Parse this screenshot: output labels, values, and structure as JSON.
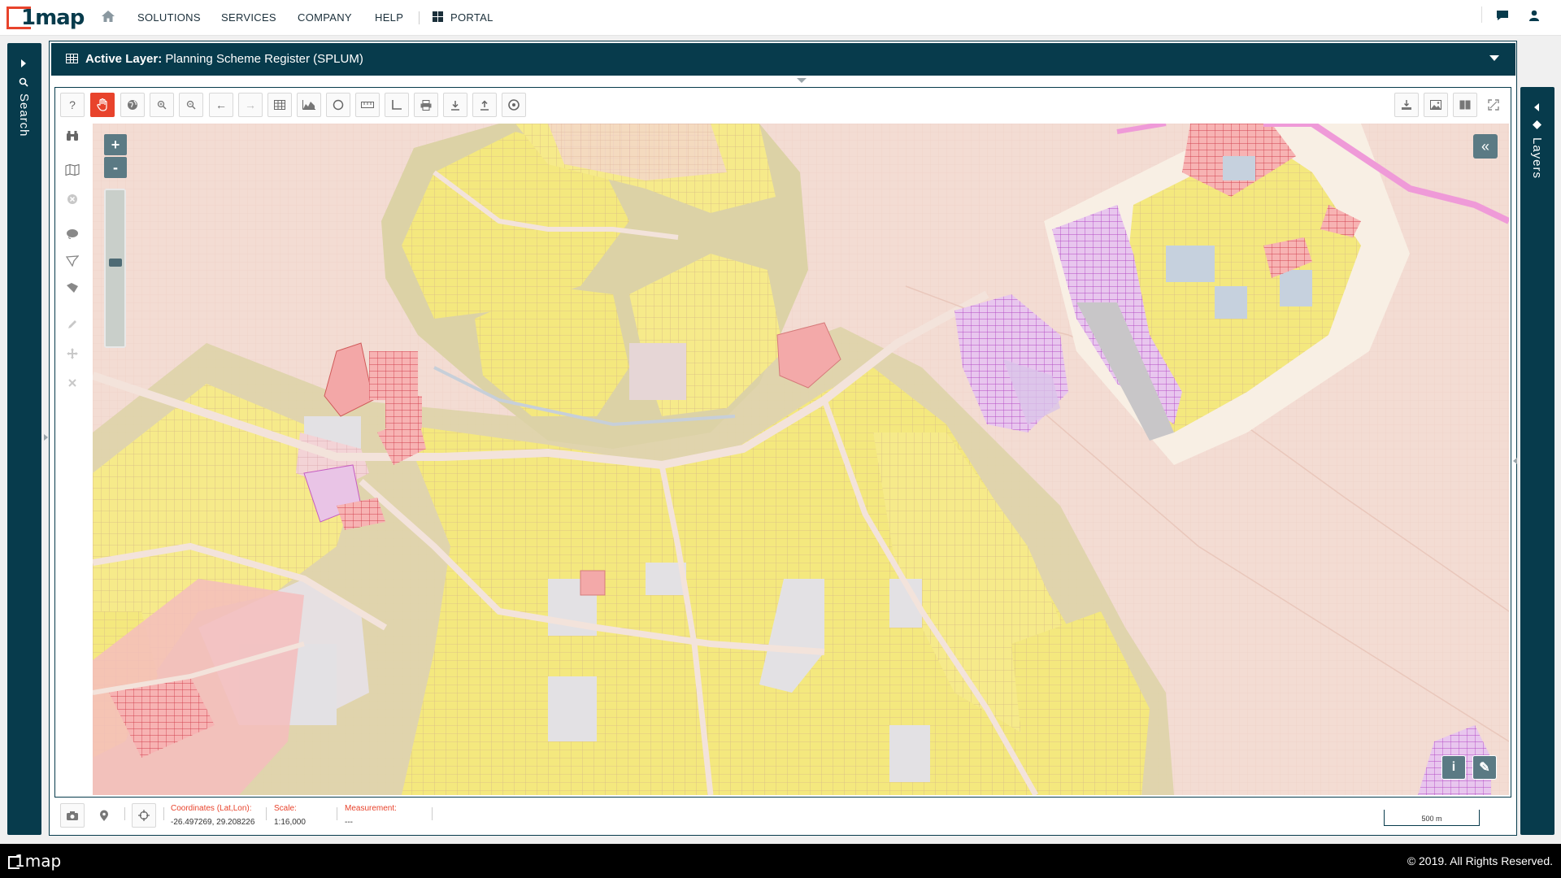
{
  "brand": {
    "logo_text": "1map",
    "accent": "#e8432c",
    "primary": "#073b4c"
  },
  "nav": {
    "home_icon": "home-icon",
    "items": [
      "SOLUTIONS",
      "SERVICES",
      "COMPANY",
      "HELP"
    ],
    "portal": "PORTAL",
    "right_icons": [
      "chat-icon",
      "user-icon"
    ]
  },
  "left_panel": {
    "label": "Search"
  },
  "right_panel": {
    "label": "Layers"
  },
  "layer_bar": {
    "prefix": "Active Layer:",
    "name": "Planning Scheme Register (SPLUM)"
  },
  "toolbar": {
    "top": [
      "help-icon",
      "pan-hand-icon",
      "globe-icon",
      "zoom-in-icon",
      "zoom-out-icon",
      "back-arrow-icon",
      "forward-arrow-icon",
      "table-icon",
      "chart-icon",
      "circle-icon",
      "ruler-icon",
      "angle-icon",
      "print-icon",
      "download-icon",
      "upload-icon",
      "settings-icon"
    ],
    "right": [
      "user-download-icon",
      "image-icon",
      "columns-icon",
      "fullscreen-icon"
    ],
    "left": [
      "binoculars-icon",
      "map-icon",
      "clear-icon",
      "lasso-circle-icon",
      "polygon-icon",
      "polygon-fill-icon",
      "pencil-icon",
      "move-icon",
      "delete-icon"
    ]
  },
  "map": {
    "zoom_in": "+",
    "zoom_out": "-",
    "zoom_level": 0.55,
    "collapse": "«",
    "info": "i",
    "edit": "✎"
  },
  "status": {
    "coords_label": "Coordinates (Lat,Lon):",
    "coords_value": "-26.497269, 29.208226",
    "scale_label": "Scale:",
    "scale_value": "1:16,000",
    "measure_label": "Measurement:",
    "measure_value": "---",
    "scalebar": "500 m"
  },
  "footer": {
    "logo": "1map",
    "copyright": "© 2019. All Rights Reserved."
  }
}
